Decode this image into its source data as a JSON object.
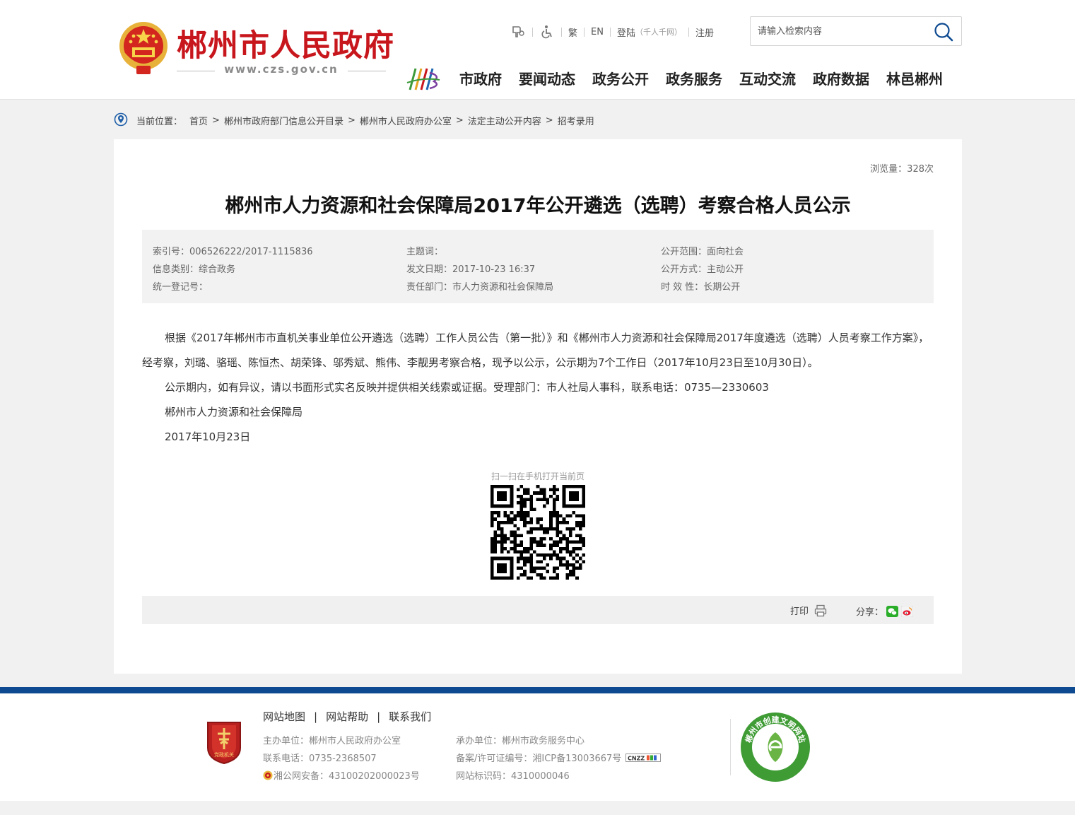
{
  "header": {
    "site_title": "郴州市人民政府",
    "site_url": "www.czs.gov.cn",
    "toplinks": {
      "traditional": "繁",
      "english": "EN",
      "login": "登陆",
      "login_note": "（千人千网）",
      "register": "注册"
    },
    "search_placeholder": "请输入检索内容",
    "nav": [
      "市政府",
      "要闻动态",
      "政务公开",
      "政务服务",
      "互动交流",
      "政府数据",
      "林邑郴州"
    ]
  },
  "breadcrumb": {
    "label": "当前位置：",
    "items": [
      "首页",
      "郴州市政府部门信息公开目录",
      "郴州市人民政府办公室",
      "法定主动公开内容",
      "招考录用"
    ],
    "separator": ">"
  },
  "article": {
    "views": "浏览量：328次",
    "title": "郴州市人力资源和社会保障局2017年公开遴选（选聘）考察合格人员公示",
    "meta": {
      "index_no": "索引号：006526222/2017-1115836",
      "category": "信息类别：综合政务",
      "reg_no": "统一登记号：",
      "subject": "主题词：",
      "date": "发文日期：2017-10-23 16:37",
      "dept": "责任部门：市人力资源和社会保障局",
      "scope": "公开范围：面向社会",
      "method": "公开方式：主动公开",
      "validity": "时 效 性：长期公开"
    },
    "paragraphs": [
      "根据《2017年郴州市市直机关事业单位公开遴选（选聘）工作人员公告（第一批）》和《郴州市人力资源和社会保障局2017年度遴选（选聘）人员考察工作方案》，经考察，刘璐、骆瑶、陈恒杰、胡荣锋、邬秀斌、熊伟、李靓男考察合格，现予以公示，公示期为7个工作日（2017年10月23日至10月30日）。",
      "公示期内，如有异议，请以书面形式实名反映并提供相关线索或证据。受理部门：市人社局人事科，联系电话：0735—2330603",
      "郴州市人力资源和社会保障局",
      "2017年10月23日"
    ],
    "qr_caption": "扫一扫在手机打开当前页",
    "print_label": "打印",
    "share_label": "分享："
  },
  "footer": {
    "links": [
      "网站地图",
      "网站帮助",
      "联系我们"
    ],
    "host": "主办单位：郴州市人民政府办公室",
    "phone": "联系电话：0735-2368507",
    "police": "湘公网安备：43100202000023号",
    "undertaker": "承办单位：郴州市政务服务中心",
    "icp": "备案/许可证编号：湘ICP备13003667号",
    "site_code": "网站标识码：4310000046",
    "party_badge_text": "党政机关",
    "civil_badge_text": "郴州市创建文明网站",
    "cnzz": "CNZZ"
  },
  "colors": {
    "brand_red": "#c8161d",
    "footer_blue": "#0e4a90",
    "civil_green": "#3f9c35"
  }
}
